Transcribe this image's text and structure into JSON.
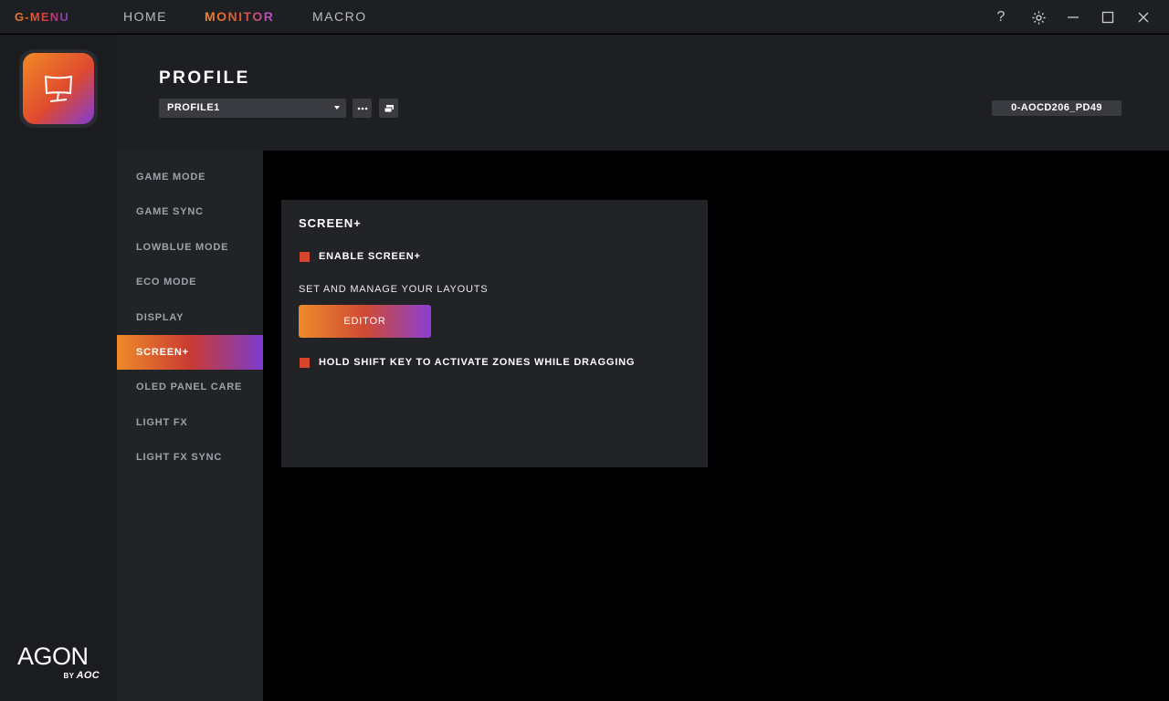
{
  "titlebar": {
    "brand": "G-MENU",
    "tabs": [
      {
        "label": "HOME",
        "active": false
      },
      {
        "label": "MONITOR",
        "active": true
      },
      {
        "label": "MACRO",
        "active": false
      }
    ],
    "help_label": "?"
  },
  "header": {
    "title": "PROFILE",
    "profile_selected": "PROFILE1",
    "device_id": "0-AOCD206_PD49"
  },
  "submenu": {
    "items": [
      {
        "label": "GAME MODE"
      },
      {
        "label": "GAME SYNC"
      },
      {
        "label": "LOWBLUE MODE"
      },
      {
        "label": "ECO MODE"
      },
      {
        "label": "DISPLAY"
      },
      {
        "label": "SCREEN+"
      },
      {
        "label": "OLED PANEL CARE"
      },
      {
        "label": "LIGHT FX"
      },
      {
        "label": "LIGHT FX SYNC"
      }
    ],
    "active": "SCREEN+"
  },
  "card": {
    "title": "SCREEN+",
    "enable_label": "ENABLE SCREEN+",
    "layouts_label": "SET AND MANAGE YOUR LAYOUTS",
    "editor_label": "EDITOR",
    "shift_label": "HOLD SHIFT KEY TO ACTIVATE ZONES WHILE DRAGGING"
  },
  "logo": {
    "agon": "AGON",
    "by": "BY",
    "aoc": "AOC"
  },
  "colors": {
    "accent_orange": "#ee8a2b",
    "accent_red": "#d8452f",
    "accent_purple": "#7d3bd0"
  }
}
